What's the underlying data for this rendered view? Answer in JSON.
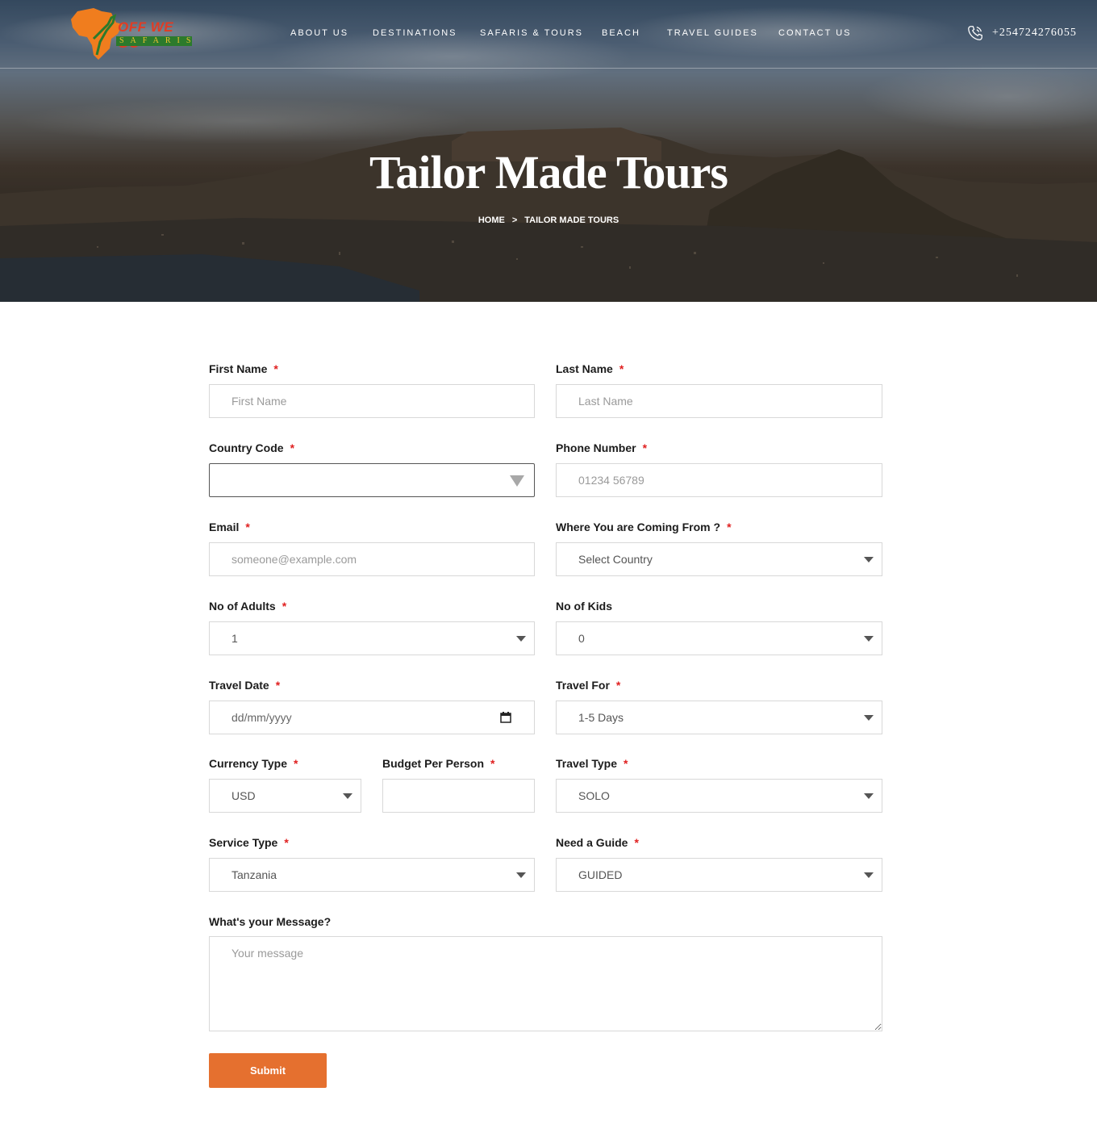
{
  "header": {
    "brand_line1": "OFF WE GO",
    "brand_line2": "SAFARIS",
    "nav": [
      "ABOUT US",
      "DESTINATIONS",
      "SAFARIS & TOURS",
      "BEACH",
      "TRAVEL GUIDES",
      "CONTACT US"
    ],
    "phone": "+254724276055"
  },
  "hero": {
    "title": "Tailor Made Tours",
    "breadcrumb": {
      "home": "HOME",
      "separator": ">",
      "current": "TAILOR MADE TOURS"
    }
  },
  "form": {
    "required_mark": "*",
    "first_name": {
      "label": "First Name",
      "placeholder": "First Name"
    },
    "last_name": {
      "label": "Last Name",
      "placeholder": "Last Name"
    },
    "country_code": {
      "label": "Country Code",
      "value": ""
    },
    "phone_number": {
      "label": "Phone Number",
      "placeholder": "01234 56789"
    },
    "email": {
      "label": "Email",
      "placeholder": "someone@example.com"
    },
    "coming_from": {
      "label": "Where You are Coming From ?",
      "value": "Select Country"
    },
    "adults": {
      "label": "No of Adults",
      "value": "1"
    },
    "kids": {
      "label": "No of Kids",
      "value": "0"
    },
    "travel_date": {
      "label": "Travel Date",
      "placeholder": "dd/mm/yyyy"
    },
    "travel_for": {
      "label": "Travel For",
      "value": "1-5 Days"
    },
    "currency": {
      "label": "Currency Type",
      "value": "USD"
    },
    "budget": {
      "label": "Budget Per Person",
      "value": ""
    },
    "travel_type": {
      "label": "Travel Type",
      "value": "SOLO"
    },
    "service_type": {
      "label": "Service Type",
      "value": "Tanzania"
    },
    "guide": {
      "label": "Need a Guide",
      "value": "GUIDED"
    },
    "message": {
      "label": "What's your Message?",
      "placeholder": "Your message"
    },
    "submit_label": "Submit"
  },
  "colors": {
    "accent": "#e5702f",
    "required": "#e02020",
    "brand_red": "#e03c24",
    "brand_green": "#2c7a2c"
  }
}
